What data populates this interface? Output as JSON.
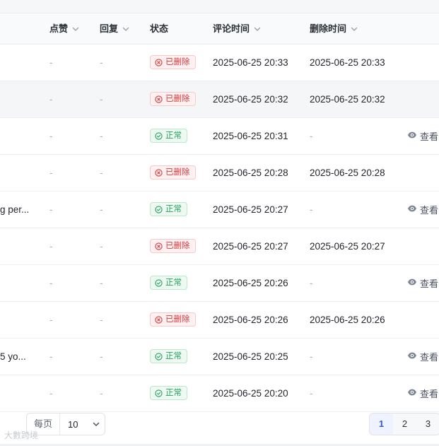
{
  "columns": [
    {
      "key": "likes",
      "label": "点赞",
      "sortable": true
    },
    {
      "key": "replies",
      "label": "回复",
      "sortable": true
    },
    {
      "key": "status",
      "label": "状态",
      "sortable": false
    },
    {
      "key": "comment_time",
      "label": "评论时间",
      "sortable": true
    },
    {
      "key": "delete_time",
      "label": "删除时间",
      "sortable": true
    }
  ],
  "rows": [
    {
      "content": "",
      "likes": "-",
      "replies": "-",
      "status": "已删除",
      "status_type": "deleted",
      "comment_time": "2025-06-25 20:33",
      "delete_time": "2025-06-25 20:33",
      "action": ""
    },
    {
      "content": "",
      "likes": "-",
      "replies": "-",
      "status": "已删除",
      "status_type": "deleted",
      "comment_time": "2025-06-25 20:32",
      "delete_time": "2025-06-25 20:32",
      "action": ""
    },
    {
      "content": "",
      "likes": "-",
      "replies": "-",
      "status": "正常",
      "status_type": "normal",
      "comment_time": "2025-06-25 20:31",
      "delete_time": "-",
      "action": "查看"
    },
    {
      "content": "",
      "likes": "-",
      "replies": "-",
      "status": "已删除",
      "status_type": "deleted",
      "comment_time": "2025-06-25 20:28",
      "delete_time": "2025-06-25 20:28",
      "action": ""
    },
    {
      "content": "g per...",
      "likes": "-",
      "replies": "-",
      "status": "正常",
      "status_type": "normal",
      "comment_time": "2025-06-25 20:27",
      "delete_time": "-",
      "action": "查看"
    },
    {
      "content": "",
      "likes": "-",
      "replies": "-",
      "status": "已删除",
      "status_type": "deleted",
      "comment_time": "2025-06-25 20:27",
      "delete_time": "2025-06-25 20:27",
      "action": ""
    },
    {
      "content": "",
      "likes": "-",
      "replies": "-",
      "status": "正常",
      "status_type": "normal",
      "comment_time": "2025-06-25 20:26",
      "delete_time": "-",
      "action": "查看"
    },
    {
      "content": "",
      "likes": "-",
      "replies": "-",
      "status": "已删除",
      "status_type": "deleted",
      "comment_time": "2025-06-25 20:26",
      "delete_time": "2025-06-25 20:26",
      "action": ""
    },
    {
      "content": "5 yo...",
      "likes": "-",
      "replies": "-",
      "status": "正常",
      "status_type": "normal",
      "comment_time": "2025-06-25 20:25",
      "delete_time": "-",
      "action": "查看"
    },
    {
      "content": "",
      "likes": "-",
      "replies": "-",
      "status": "正常",
      "status_type": "normal",
      "comment_time": "2025-06-25 20:20",
      "delete_time": "-",
      "action": "查看"
    }
  ],
  "pagination": {
    "per_page_label": "每页",
    "per_page_value": "10",
    "pages": [
      "1",
      "2",
      "3"
    ],
    "current_page": "1"
  },
  "watermark": "大數跨境",
  "colors": {
    "deleted": "#d23b3b",
    "normal": "#25a060",
    "active_page": "#2e5bd8"
  },
  "icons": {
    "sort": "chevron-down-icon",
    "deleted": "x-circle-icon",
    "normal": "check-circle-icon",
    "view": "eye-icon",
    "dropdown": "chevron-down-icon"
  }
}
